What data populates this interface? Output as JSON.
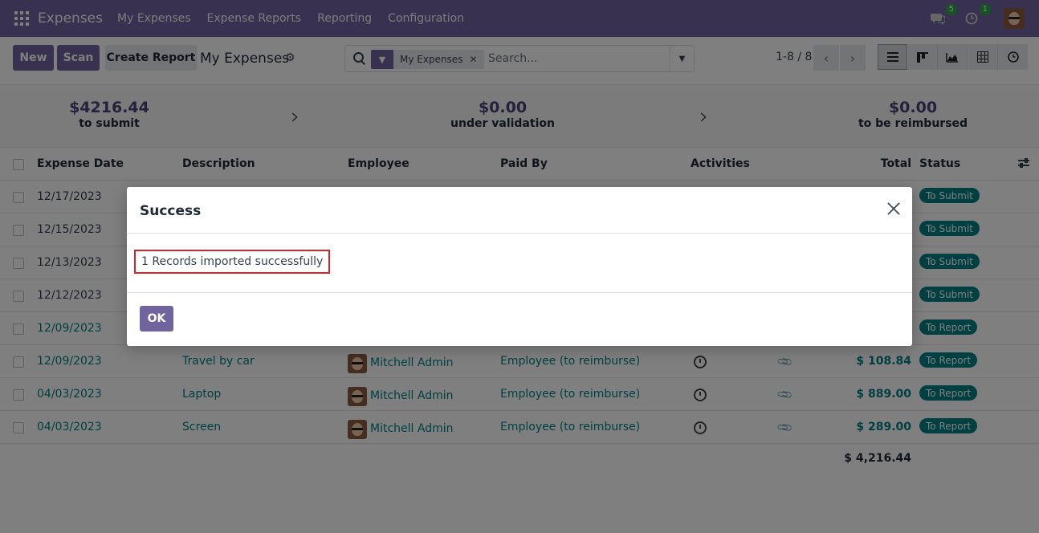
{
  "navbar": {
    "app_name": "Expenses",
    "menus": [
      "My Expenses",
      "Expense Reports",
      "Reporting",
      "Configuration"
    ],
    "messages_count": "5",
    "activities_count": "1"
  },
  "control": {
    "new_label": "New",
    "scan_label": "Scan",
    "create_report_label": "Create Report",
    "breadcrumb": "My Expenses",
    "facet_label": "My Expenses",
    "search_placeholder": "Search...",
    "pager": "1-8 / 8"
  },
  "summary": [
    {
      "amount": "$4216.44",
      "label": "to submit"
    },
    {
      "amount": "$0.00",
      "label": "under validation"
    },
    {
      "amount": "$0.00",
      "label": "to be reimbursed"
    }
  ],
  "table": {
    "headers": {
      "date": "Expense Date",
      "description": "Description",
      "employee": "Employee",
      "paid_by": "Paid By",
      "activities": "Activities",
      "total": "Total",
      "status": "Status"
    },
    "rows": [
      {
        "date": "12/17/2023",
        "description": "",
        "employee": "",
        "paid_by": "",
        "total": "",
        "status": "To Submit"
      },
      {
        "date": "12/15/2023",
        "description": "",
        "employee": "",
        "paid_by": "",
        "total": "",
        "status": "To Submit"
      },
      {
        "date": "12/13/2023",
        "description": "",
        "employee": "",
        "paid_by": "",
        "total": "",
        "status": "To Submit"
      },
      {
        "date": "12/12/2023",
        "description": "",
        "employee": "",
        "paid_by": "",
        "total": "",
        "status": "To Submit"
      },
      {
        "date": "12/09/2023",
        "description": "",
        "employee": "",
        "paid_by": "",
        "total": "",
        "status": "To Report"
      },
      {
        "date": "12/09/2023",
        "description": "Travel by car",
        "employee": "Mitchell Admin",
        "paid_by": "Employee (to reimburse)",
        "total": "$ 108.84",
        "status": "To Report"
      },
      {
        "date": "04/03/2023",
        "description": "Laptop",
        "employee": "Mitchell Admin",
        "paid_by": "Employee (to reimburse)",
        "total": "$ 889.00",
        "status": "To Report"
      },
      {
        "date": "04/03/2023",
        "description": "Screen",
        "employee": "Mitchell Admin",
        "paid_by": "Employee (to reimburse)",
        "total": "$ 289.00",
        "status": "To Report"
      }
    ],
    "grand_total": "$ 4,216.44"
  },
  "modal": {
    "title": "Success",
    "message": "1 Records imported successfully",
    "ok_label": "OK"
  },
  "colors": {
    "brand": "#71639e",
    "link": "#017e84",
    "highlight_border": "#d4252b"
  }
}
